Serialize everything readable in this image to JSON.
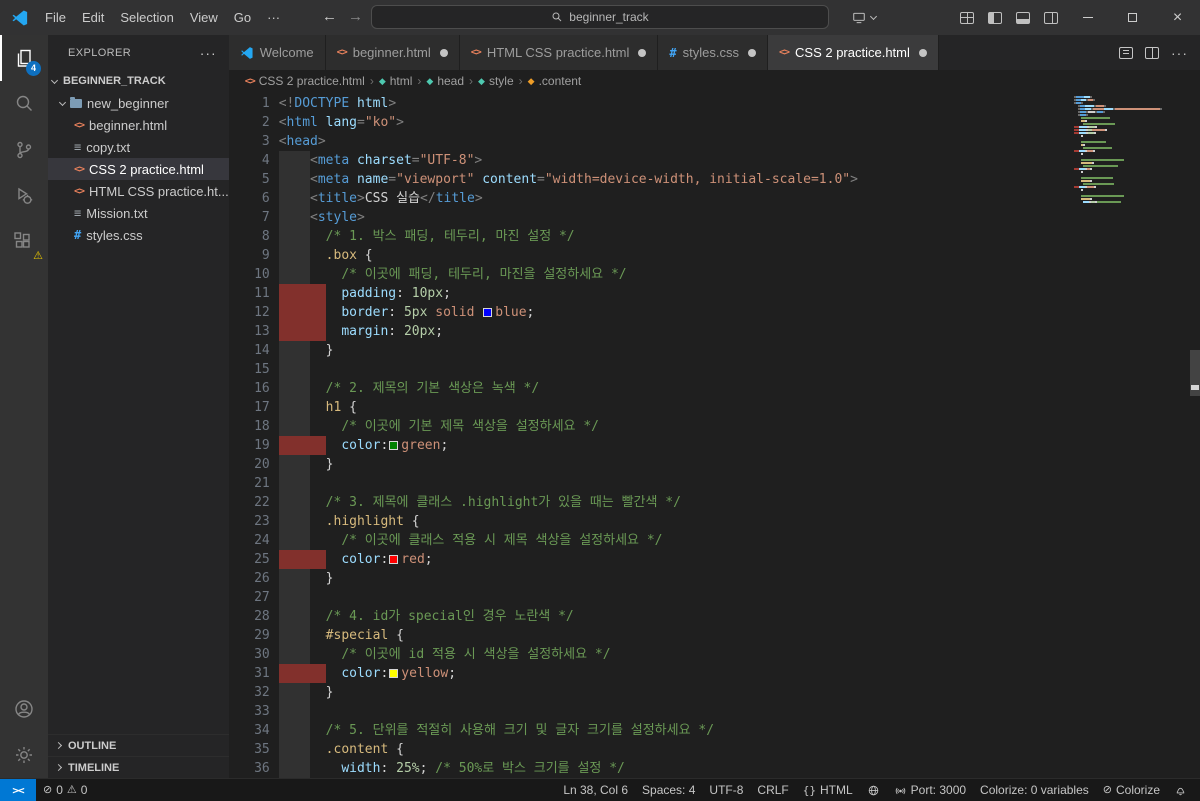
{
  "titlebar": {
    "menus": [
      "File",
      "Edit",
      "Selection",
      "View",
      "Go",
      "···"
    ],
    "search": "beginner_track"
  },
  "activity_bar": {
    "explorer_badge": "4"
  },
  "sidebar": {
    "header": "EXPLORER",
    "root": "BEGINNER_TRACK",
    "items": [
      {
        "label": "new_beginner",
        "icon": "folder",
        "expanded": true
      },
      {
        "label": "beginner.html",
        "icon": "html"
      },
      {
        "label": "copy.txt",
        "icon": "txt"
      },
      {
        "label": "CSS 2 practice.html",
        "icon": "html",
        "selected": true
      },
      {
        "label": "HTML CSS practice.ht...",
        "icon": "html"
      },
      {
        "label": "Mission.txt",
        "icon": "txt"
      },
      {
        "label": "styles.css",
        "icon": "css"
      }
    ],
    "panels": [
      "OUTLINE",
      "TIMELINE"
    ]
  },
  "tabs": [
    {
      "label": "Welcome",
      "icon": "vscode",
      "dirty": false,
      "active": false
    },
    {
      "label": "beginner.html",
      "icon": "html",
      "dirty": true,
      "active": false
    },
    {
      "label": "HTML CSS practice.html",
      "icon": "html",
      "dirty": true,
      "active": false
    },
    {
      "label": "styles.css",
      "icon": "css",
      "dirty": true,
      "active": false
    },
    {
      "label": "CSS 2 practice.html",
      "icon": "html",
      "dirty": true,
      "active": true
    }
  ],
  "breadcrumbs": {
    "items": [
      {
        "label": "CSS 2 practice.html",
        "icon": "file-html"
      },
      {
        "label": "html",
        "icon": "symbol-element"
      },
      {
        "label": "head",
        "icon": "symbol-element"
      },
      {
        "label": "style",
        "icon": "symbol-element"
      },
      {
        "label": ".content",
        "icon": "symbol-class"
      }
    ]
  },
  "editor": {
    "lines": [
      {
        "n": 1,
        "ind": 0,
        "band": null,
        "seg": [
          [
            "p",
            "<!"
          ],
          [
            "t",
            "DOCTYPE"
          ],
          [
            "a",
            " html"
          ],
          [
            "p",
            ">"
          ]
        ]
      },
      {
        "n": 2,
        "ind": 0,
        "band": null,
        "seg": [
          [
            "p",
            "<"
          ],
          [
            "t",
            "html"
          ],
          [
            "a",
            " lang"
          ],
          [
            "p",
            "="
          ],
          [
            "s",
            "\"ko\""
          ],
          [
            "p",
            ">"
          ]
        ]
      },
      {
        "n": 3,
        "ind": 0,
        "band": null,
        "seg": [
          [
            "p",
            "<"
          ],
          [
            "t",
            "head"
          ],
          [
            "p",
            ">"
          ]
        ]
      },
      {
        "n": 4,
        "ind": 4,
        "band": {
          "c": "gray",
          "w": 4
        },
        "seg": [
          [
            "p",
            "<"
          ],
          [
            "t",
            "meta"
          ],
          [
            "a",
            " charset"
          ],
          [
            "p",
            "="
          ],
          [
            "s",
            "\"UTF-8\""
          ],
          [
            "p",
            ">"
          ]
        ]
      },
      {
        "n": 5,
        "ind": 4,
        "band": {
          "c": "gray",
          "w": 4
        },
        "seg": [
          [
            "p",
            "<"
          ],
          [
            "t",
            "meta"
          ],
          [
            "a",
            " name"
          ],
          [
            "p",
            "="
          ],
          [
            "s",
            "\"viewport\""
          ],
          [
            "a",
            " content"
          ],
          [
            "p",
            "="
          ],
          [
            "s",
            "\"width=device-width, initial-scale=1.0\""
          ],
          [
            "p",
            ">"
          ]
        ]
      },
      {
        "n": 6,
        "ind": 4,
        "band": {
          "c": "gray",
          "w": 4
        },
        "seg": [
          [
            "p",
            "<"
          ],
          [
            "t",
            "title"
          ],
          [
            "p",
            ">"
          ],
          [
            "x",
            "CSS 실습"
          ],
          [
            "p",
            "</"
          ],
          [
            "t",
            "title"
          ],
          [
            "p",
            ">"
          ]
        ]
      },
      {
        "n": 7,
        "ind": 4,
        "band": {
          "c": "gray",
          "w": 4
        },
        "seg": [
          [
            "p",
            "<"
          ],
          [
            "t",
            "style"
          ],
          [
            "p",
            ">"
          ]
        ]
      },
      {
        "n": 8,
        "ind": 6,
        "band": {
          "c": "gray",
          "w": 4
        },
        "seg": [
          [
            "c",
            "/* 1. 박스 패딩, 테두리, 마진 설정 */"
          ]
        ]
      },
      {
        "n": 9,
        "ind": 6,
        "band": {
          "c": "gray",
          "w": 4
        },
        "seg": [
          [
            "sel",
            ".box"
          ],
          [
            "x",
            " {"
          ]
        ]
      },
      {
        "n": 10,
        "ind": 8,
        "band": {
          "c": "gray",
          "w": 4
        },
        "seg": [
          [
            "c",
            "/* 이곳에 패딩, 테두리, 마진을 설정하세요 */"
          ]
        ]
      },
      {
        "n": 11,
        "ind": 8,
        "band": {
          "c": "red",
          "w": 6
        },
        "seg": [
          [
            "pr",
            "padding"
          ],
          [
            "x",
            ":"
          ],
          [
            "n",
            " 10px"
          ],
          [
            "x",
            ";"
          ]
        ]
      },
      {
        "n": 12,
        "ind": 8,
        "band": {
          "c": "red",
          "w": 6
        },
        "seg": [
          [
            "pr",
            "border"
          ],
          [
            "x",
            ":"
          ],
          [
            "n",
            " 5px"
          ],
          [
            "v",
            " solid "
          ],
          [
            "sw",
            "#0000ff"
          ],
          [
            "v",
            "blue"
          ],
          [
            "x",
            ";"
          ]
        ]
      },
      {
        "n": 13,
        "ind": 8,
        "band": {
          "c": "red",
          "w": 6
        },
        "seg": [
          [
            "pr",
            "margin"
          ],
          [
            "x",
            ":"
          ],
          [
            "n",
            " 20px"
          ],
          [
            "x",
            ";"
          ]
        ]
      },
      {
        "n": 14,
        "ind": 6,
        "band": {
          "c": "gray",
          "w": 4
        },
        "seg": [
          [
            "x",
            "}"
          ]
        ]
      },
      {
        "n": 15,
        "ind": 0,
        "band": {
          "c": "gray",
          "w": 4
        },
        "seg": []
      },
      {
        "n": 16,
        "ind": 6,
        "band": {
          "c": "gray",
          "w": 4
        },
        "seg": [
          [
            "c",
            "/* 2. 제목의 기본 색상은 녹색 */"
          ]
        ]
      },
      {
        "n": 17,
        "ind": 6,
        "band": {
          "c": "gray",
          "w": 4
        },
        "seg": [
          [
            "sel",
            "h1"
          ],
          [
            "x",
            " {"
          ]
        ]
      },
      {
        "n": 18,
        "ind": 8,
        "band": {
          "c": "gray",
          "w": 4
        },
        "seg": [
          [
            "c",
            "/* 이곳에 기본 제목 색상을 설정하세요 */"
          ]
        ]
      },
      {
        "n": 19,
        "ind": 8,
        "band": {
          "c": "red",
          "w": 6
        },
        "seg": [
          [
            "pr",
            "color"
          ],
          [
            "x",
            ":"
          ],
          [
            "sw",
            "#008000"
          ],
          [
            "v",
            "green"
          ],
          [
            "x",
            ";"
          ]
        ]
      },
      {
        "n": 20,
        "ind": 6,
        "band": {
          "c": "gray",
          "w": 4
        },
        "seg": [
          [
            "x",
            "}"
          ]
        ]
      },
      {
        "n": 21,
        "ind": 0,
        "band": {
          "c": "gray",
          "w": 4
        },
        "seg": []
      },
      {
        "n": 22,
        "ind": 6,
        "band": {
          "c": "gray",
          "w": 4
        },
        "seg": [
          [
            "c",
            "/* 3. 제목에 클래스 .highlight가 있을 때는 빨간색 */"
          ]
        ]
      },
      {
        "n": 23,
        "ind": 6,
        "band": {
          "c": "gray",
          "w": 4
        },
        "seg": [
          [
            "sel",
            ".highlight"
          ],
          [
            "x",
            " {"
          ]
        ]
      },
      {
        "n": 24,
        "ind": 8,
        "band": {
          "c": "gray",
          "w": 4
        },
        "seg": [
          [
            "c",
            "/* 이곳에 클래스 적용 시 제목 색상을 설정하세요 */"
          ]
        ]
      },
      {
        "n": 25,
        "ind": 8,
        "band": {
          "c": "red",
          "w": 6
        },
        "seg": [
          [
            "pr",
            "color"
          ],
          [
            "x",
            ":"
          ],
          [
            "sw",
            "#ff0000"
          ],
          [
            "v",
            "red"
          ],
          [
            "x",
            ";"
          ]
        ]
      },
      {
        "n": 26,
        "ind": 6,
        "band": {
          "c": "gray",
          "w": 4
        },
        "seg": [
          [
            "x",
            "}"
          ]
        ]
      },
      {
        "n": 27,
        "ind": 0,
        "band": {
          "c": "gray",
          "w": 4
        },
        "seg": []
      },
      {
        "n": 28,
        "ind": 6,
        "band": {
          "c": "gray",
          "w": 4
        },
        "seg": [
          [
            "c",
            "/* 4. id가 special인 경우 노란색 */"
          ]
        ]
      },
      {
        "n": 29,
        "ind": 6,
        "band": {
          "c": "gray",
          "w": 4
        },
        "seg": [
          [
            "sel",
            "#special"
          ],
          [
            "x",
            " {"
          ]
        ]
      },
      {
        "n": 30,
        "ind": 8,
        "band": {
          "c": "gray",
          "w": 4
        },
        "seg": [
          [
            "c",
            "/* 이곳에 id 적용 시 색상을 설정하세요 */"
          ]
        ]
      },
      {
        "n": 31,
        "ind": 8,
        "band": {
          "c": "red",
          "w": 6
        },
        "seg": [
          [
            "pr",
            "color"
          ],
          [
            "x",
            ":"
          ],
          [
            "sw",
            "#ffff00"
          ],
          [
            "v",
            "yellow"
          ],
          [
            "x",
            ";"
          ]
        ]
      },
      {
        "n": 32,
        "ind": 6,
        "band": {
          "c": "gray",
          "w": 4
        },
        "seg": [
          [
            "x",
            "}"
          ]
        ]
      },
      {
        "n": 33,
        "ind": 0,
        "band": {
          "c": "gray",
          "w": 4
        },
        "seg": []
      },
      {
        "n": 34,
        "ind": 6,
        "band": {
          "c": "gray",
          "w": 4
        },
        "seg": [
          [
            "c",
            "/* 5. 단위를 적절히 사용해 크기 및 글자 크기를 설정하세요 */"
          ]
        ]
      },
      {
        "n": 35,
        "ind": 6,
        "band": {
          "c": "gray",
          "w": 4
        },
        "seg": [
          [
            "sel",
            ".content"
          ],
          [
            "x",
            " {"
          ]
        ]
      },
      {
        "n": 36,
        "ind": 8,
        "band": {
          "c": "gray",
          "w": 4
        },
        "seg": [
          [
            "pr",
            "width"
          ],
          [
            "x",
            ":"
          ],
          [
            "n",
            " 25%"
          ],
          [
            "x",
            ";"
          ],
          [
            "c",
            " /* 50%로 박스 크기를 설정 */"
          ]
        ]
      }
    ]
  },
  "status_bar": {
    "remote": "><",
    "problems": {
      "errors": "0",
      "warnings": "0"
    },
    "cursor": "Ln 38, Col 6",
    "indent": "Spaces: 4",
    "encoding": "UTF-8",
    "eol": "CRLF",
    "language_icon": "{}",
    "language": "HTML",
    "port": "Port: 3000",
    "colorize_vars": "Colorize: 0 variables",
    "colorize": "Colorize"
  }
}
